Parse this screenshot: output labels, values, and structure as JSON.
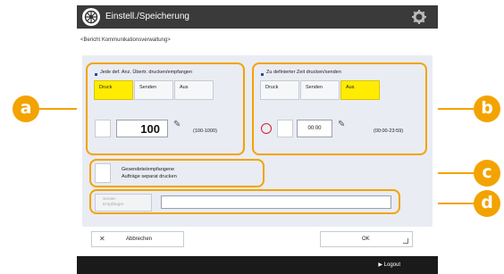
{
  "window": {
    "title": "Einstell./Speicherung",
    "breadcrumb": "<Bericht Kommunikationsverwaltung>"
  },
  "group_a": {
    "title": "Jede def. Anz. Übertr. drucken/empfangen",
    "options": [
      "Druck",
      "Senden",
      "Aus"
    ],
    "selected": [
      "Druck"
    ],
    "value": "100",
    "range": "(100-1000)"
  },
  "group_b": {
    "title": "Zu definierter Zeit drucken/senden",
    "options": [
      "Druck",
      "Senden",
      "Aus"
    ],
    "selected": [
      "Aus"
    ],
    "value": "00:00",
    "range": "(00:00-23:59)"
  },
  "group_c": {
    "label_line1": "Gesendete/empfangene",
    "label_line2": "Aufträge separat drucken"
  },
  "group_d": {
    "button_label_line1": "Sende-",
    "button_label_line2": "Empfänger",
    "input_value": ""
  },
  "footer": {
    "cancel_label": "Abbrechen",
    "ok_label": "OK"
  },
  "bottom": {
    "logout_label": "Logout"
  },
  "callouts": [
    "a",
    "b",
    "c",
    "d"
  ],
  "colors": {
    "accent": "#f3a300",
    "selected": "#ffec00",
    "title_bar": "#3a3a3a",
    "clock": "#d4202c"
  }
}
